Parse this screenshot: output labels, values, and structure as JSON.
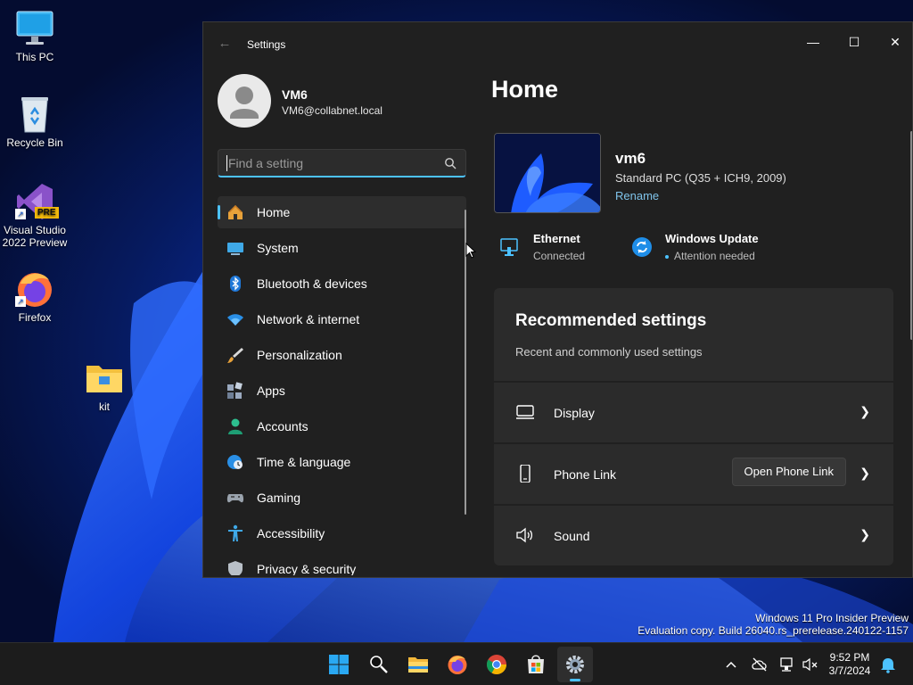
{
  "desktop": {
    "icons": [
      {
        "label": "This PC",
        "icon": "monitor-icon"
      },
      {
        "label": "Recycle Bin",
        "icon": "recycle-bin-icon"
      },
      {
        "label": "Visual Studio\n2022 Preview",
        "icon": "visual-studio-icon",
        "badge": "PRE"
      },
      {
        "label": "Firefox",
        "icon": "firefox-icon"
      },
      {
        "label": "kit",
        "icon": "folder-icon"
      }
    ],
    "watermark": {
      "line1": "Windows 11 Pro Insider Preview",
      "line2": "Evaluation copy. Build 26040.rs_prerelease.240122-1157"
    }
  },
  "window": {
    "title": "Settings",
    "caption": {
      "minimize": "—",
      "maximize": "☐",
      "close": "✕"
    }
  },
  "profile": {
    "name": "VM6",
    "email": "VM6@collabnet.local"
  },
  "search": {
    "placeholder": "Find a setting",
    "value": ""
  },
  "nav": {
    "items": [
      {
        "label": "Home",
        "icon": "home-icon",
        "selected": true
      },
      {
        "label": "System",
        "icon": "system-icon"
      },
      {
        "label": "Bluetooth & devices",
        "icon": "bluetooth-icon"
      },
      {
        "label": "Network & internet",
        "icon": "wifi-icon"
      },
      {
        "label": "Personalization",
        "icon": "paintbrush-icon"
      },
      {
        "label": "Apps",
        "icon": "apps-icon"
      },
      {
        "label": "Accounts",
        "icon": "accounts-icon"
      },
      {
        "label": "Time & language",
        "icon": "globe-clock-icon"
      },
      {
        "label": "Gaming",
        "icon": "gamepad-icon"
      },
      {
        "label": "Accessibility",
        "icon": "accessibility-icon"
      },
      {
        "label": "Privacy & security",
        "icon": "shield-icon"
      }
    ]
  },
  "main": {
    "page_title": "Home",
    "device": {
      "name": "vm6",
      "model": "Standard PC (Q35 + ICH9, 2009)",
      "rename": "Rename"
    },
    "status": {
      "ethernet": {
        "title": "Ethernet",
        "sub": "Connected"
      },
      "update": {
        "title": "Windows Update",
        "sub": "Attention needed"
      }
    },
    "recommended": {
      "title": "Recommended settings",
      "subtitle": "Recent and commonly used settings",
      "rows": [
        {
          "label": "Display",
          "icon": "display-icon"
        },
        {
          "label": "Phone Link",
          "icon": "phone-icon",
          "action": "Open Phone Link"
        },
        {
          "label": "Sound",
          "icon": "speaker-icon"
        }
      ]
    }
  },
  "taskbar": {
    "apps": [
      "start-icon",
      "search-icon",
      "file-explorer-icon",
      "firefox-icon",
      "chrome-icon",
      "store-icon",
      "settings-icon"
    ],
    "active_app": "settings-icon",
    "clock": {
      "time": "9:52 PM",
      "date": "3/7/2024"
    }
  },
  "colors": {
    "accent": "#4cc2ff",
    "window_bg": "#202020",
    "card_bg": "#2b2b2b",
    "link": "#7fc3ea"
  }
}
